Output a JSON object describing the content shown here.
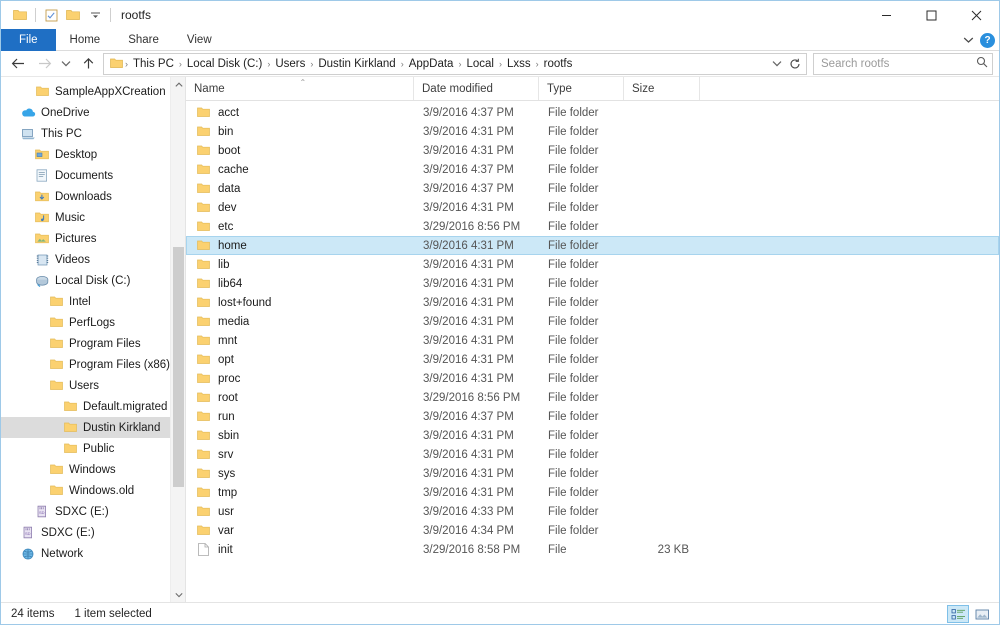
{
  "window": {
    "title": "rootfs",
    "quick_access": [
      "folder-icon",
      "properties-icon",
      "new-folder-icon",
      "customize-dropdown-icon"
    ],
    "controls": {
      "minimize": "—",
      "maximize": "☐",
      "close": "✕"
    }
  },
  "ribbon": {
    "tabs": [
      {
        "label": "File",
        "active": true
      },
      {
        "label": "Home",
        "active": false
      },
      {
        "label": "Share",
        "active": false
      },
      {
        "label": "View",
        "active": false
      }
    ],
    "expand_label": "⌄",
    "help_label": "?"
  },
  "nav": {
    "back": "←",
    "forward": "→",
    "recent": "⌄",
    "up": "↑",
    "refresh": "↻",
    "history_dropdown": "⌄"
  },
  "breadcrumb": {
    "separator": "›",
    "items": [
      "This PC",
      "Local Disk (C:)",
      "Users",
      "Dustin Kirkland",
      "AppData",
      "Local",
      "Lxss",
      "rootfs"
    ]
  },
  "search": {
    "placeholder": "Search rootfs",
    "icon": "search-icon"
  },
  "sidebar": {
    "items": [
      {
        "label": "SampleAppXCreation",
        "icon": "folder-icon",
        "indent": 2,
        "selected": false
      },
      {
        "label": "OneDrive",
        "icon": "onedrive-icon",
        "indent": 1,
        "selected": false
      },
      {
        "label": "This PC",
        "icon": "thispc-icon",
        "indent": 1,
        "selected": false
      },
      {
        "label": "Desktop",
        "icon": "desktop-icon",
        "indent": 2,
        "selected": false
      },
      {
        "label": "Documents",
        "icon": "documents-icon",
        "indent": 2,
        "selected": false
      },
      {
        "label": "Downloads",
        "icon": "downloads-icon",
        "indent": 2,
        "selected": false
      },
      {
        "label": "Music",
        "icon": "music-icon",
        "indent": 2,
        "selected": false
      },
      {
        "label": "Pictures",
        "icon": "pictures-icon",
        "indent": 2,
        "selected": false
      },
      {
        "label": "Videos",
        "icon": "videos-icon",
        "indent": 2,
        "selected": false
      },
      {
        "label": "Local Disk (C:)",
        "icon": "harddisk-icon",
        "indent": 2,
        "selected": false
      },
      {
        "label": "Intel",
        "icon": "folder-icon",
        "indent": 3,
        "selected": false
      },
      {
        "label": "PerfLogs",
        "icon": "folder-icon",
        "indent": 3,
        "selected": false
      },
      {
        "label": "Program Files",
        "icon": "folder-icon",
        "indent": 3,
        "selected": false
      },
      {
        "label": "Program Files (x86)",
        "icon": "folder-icon",
        "indent": 3,
        "selected": false
      },
      {
        "label": "Users",
        "icon": "folder-icon",
        "indent": 3,
        "selected": false
      },
      {
        "label": "Default.migrated",
        "icon": "folder-icon",
        "indent": 4,
        "selected": false
      },
      {
        "label": "Dustin Kirkland",
        "icon": "folder-icon",
        "indent": 4,
        "selected": true
      },
      {
        "label": "Public",
        "icon": "folder-icon",
        "indent": 4,
        "selected": false
      },
      {
        "label": "Windows",
        "icon": "folder-icon",
        "indent": 3,
        "selected": false
      },
      {
        "label": "Windows.old",
        "icon": "folder-icon",
        "indent": 3,
        "selected": false
      },
      {
        "label": "SDXC (E:)",
        "icon": "sdcard-icon",
        "indent": 2,
        "selected": false
      },
      {
        "label": "SDXC (E:)",
        "icon": "sdcard-icon",
        "indent": 1,
        "selected": false
      },
      {
        "label": "Network",
        "icon": "network-icon",
        "indent": 1,
        "selected": false
      }
    ]
  },
  "filelist": {
    "columns": [
      {
        "label": "Name",
        "sorted": true,
        "sort_caret": "⌃"
      },
      {
        "label": "Date modified",
        "sorted": false
      },
      {
        "label": "Type",
        "sorted": false
      },
      {
        "label": "Size",
        "sorted": false
      }
    ],
    "rows": [
      {
        "name": "acct",
        "date": "3/9/2016 4:37 PM",
        "type": "File folder",
        "size": "",
        "icon": "folder-icon",
        "selected": false
      },
      {
        "name": "bin",
        "date": "3/9/2016 4:31 PM",
        "type": "File folder",
        "size": "",
        "icon": "folder-icon",
        "selected": false
      },
      {
        "name": "boot",
        "date": "3/9/2016 4:31 PM",
        "type": "File folder",
        "size": "",
        "icon": "folder-icon",
        "selected": false
      },
      {
        "name": "cache",
        "date": "3/9/2016 4:37 PM",
        "type": "File folder",
        "size": "",
        "icon": "folder-icon",
        "selected": false
      },
      {
        "name": "data",
        "date": "3/9/2016 4:37 PM",
        "type": "File folder",
        "size": "",
        "icon": "folder-icon",
        "selected": false
      },
      {
        "name": "dev",
        "date": "3/9/2016 4:31 PM",
        "type": "File folder",
        "size": "",
        "icon": "folder-icon",
        "selected": false
      },
      {
        "name": "etc",
        "date": "3/29/2016 8:56 PM",
        "type": "File folder",
        "size": "",
        "icon": "folder-icon",
        "selected": false
      },
      {
        "name": "home",
        "date": "3/9/2016 4:31 PM",
        "type": "File folder",
        "size": "",
        "icon": "folder-icon",
        "selected": true
      },
      {
        "name": "lib",
        "date": "3/9/2016 4:31 PM",
        "type": "File folder",
        "size": "",
        "icon": "folder-icon",
        "selected": false
      },
      {
        "name": "lib64",
        "date": "3/9/2016 4:31 PM",
        "type": "File folder",
        "size": "",
        "icon": "folder-icon",
        "selected": false
      },
      {
        "name": "lost+found",
        "date": "3/9/2016 4:31 PM",
        "type": "File folder",
        "size": "",
        "icon": "folder-icon",
        "selected": false
      },
      {
        "name": "media",
        "date": "3/9/2016 4:31 PM",
        "type": "File folder",
        "size": "",
        "icon": "folder-icon",
        "selected": false
      },
      {
        "name": "mnt",
        "date": "3/9/2016 4:31 PM",
        "type": "File folder",
        "size": "",
        "icon": "folder-icon",
        "selected": false
      },
      {
        "name": "opt",
        "date": "3/9/2016 4:31 PM",
        "type": "File folder",
        "size": "",
        "icon": "folder-icon",
        "selected": false
      },
      {
        "name": "proc",
        "date": "3/9/2016 4:31 PM",
        "type": "File folder",
        "size": "",
        "icon": "folder-icon",
        "selected": false
      },
      {
        "name": "root",
        "date": "3/29/2016 8:56 PM",
        "type": "File folder",
        "size": "",
        "icon": "folder-icon",
        "selected": false
      },
      {
        "name": "run",
        "date": "3/9/2016 4:37 PM",
        "type": "File folder",
        "size": "",
        "icon": "folder-icon",
        "selected": false
      },
      {
        "name": "sbin",
        "date": "3/9/2016 4:31 PM",
        "type": "File folder",
        "size": "",
        "icon": "folder-icon",
        "selected": false
      },
      {
        "name": "srv",
        "date": "3/9/2016 4:31 PM",
        "type": "File folder",
        "size": "",
        "icon": "folder-icon",
        "selected": false
      },
      {
        "name": "sys",
        "date": "3/9/2016 4:31 PM",
        "type": "File folder",
        "size": "",
        "icon": "folder-icon",
        "selected": false
      },
      {
        "name": "tmp",
        "date": "3/9/2016 4:31 PM",
        "type": "File folder",
        "size": "",
        "icon": "folder-icon",
        "selected": false
      },
      {
        "name": "usr",
        "date": "3/9/2016 4:33 PM",
        "type": "File folder",
        "size": "",
        "icon": "folder-icon",
        "selected": false
      },
      {
        "name": "var",
        "date": "3/9/2016 4:34 PM",
        "type": "File folder",
        "size": "",
        "icon": "folder-icon",
        "selected": false
      },
      {
        "name": "init",
        "date": "3/29/2016 8:58 PM",
        "type": "File",
        "size": "23 KB",
        "icon": "file-icon",
        "selected": false
      }
    ]
  },
  "status": {
    "item_count": "24 items",
    "selection": "1 item selected",
    "views": [
      {
        "name": "details-view",
        "active": true
      },
      {
        "name": "large-icons-view",
        "active": false
      }
    ]
  },
  "colors": {
    "accent": "#1f6fc4",
    "selection": "#cce8f7",
    "folder": "#fbd170",
    "help": "#2a8fdd"
  }
}
